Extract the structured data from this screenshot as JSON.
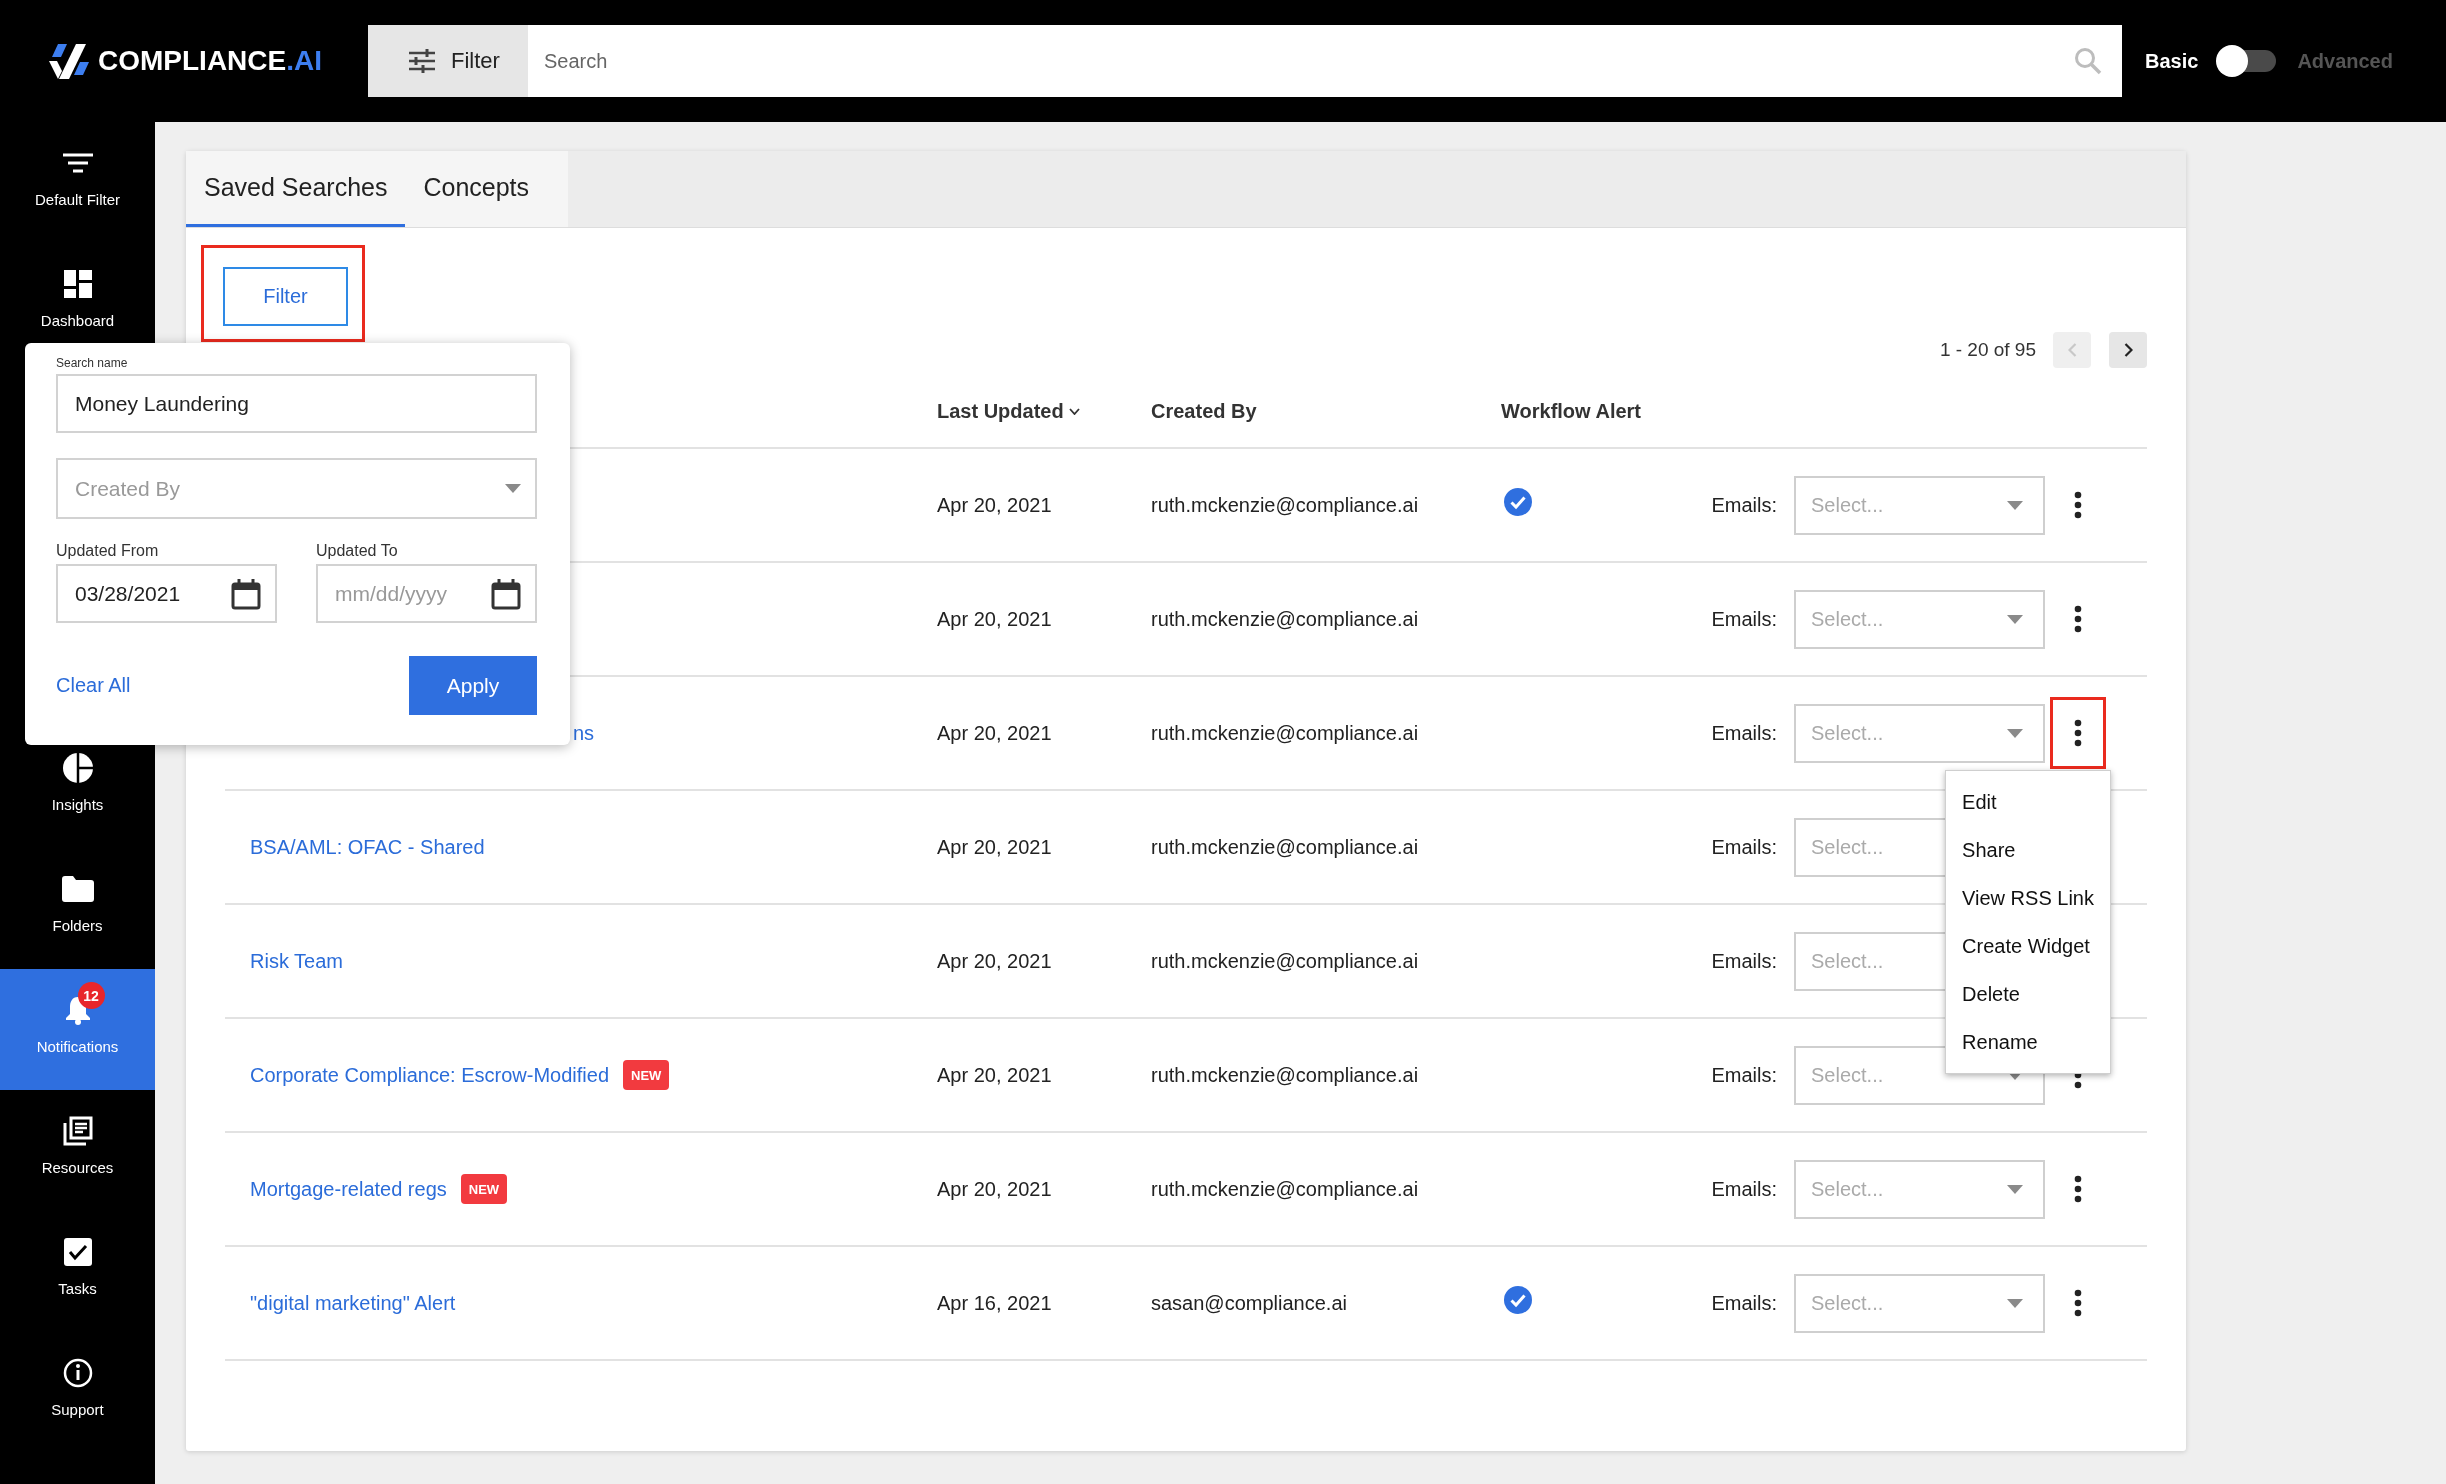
{
  "header": {
    "logo": {
      "name": "COMPLIANCE",
      "suffix": ".AI"
    },
    "filter_button": "Filter",
    "search": {
      "placeholder": "Search"
    },
    "mode_toggle": {
      "left_label": "Basic",
      "right_label": "Advanced",
      "on": false
    }
  },
  "sidebar": {
    "items": [
      {
        "label": "Default Filter",
        "selected": false
      },
      {
        "label": "Dashboard",
        "selected": false
      },
      {
        "label": "Insights",
        "selected": false
      },
      {
        "label": "Folders",
        "selected": false
      },
      {
        "label": "Notifications",
        "selected": true,
        "badge": "12"
      },
      {
        "label": "Resources",
        "selected": false
      },
      {
        "label": "Tasks",
        "selected": false
      },
      {
        "label": "Support",
        "selected": false
      }
    ]
  },
  "tabs": [
    {
      "label": "Saved Searches",
      "selected": true
    },
    {
      "label": "Concepts",
      "selected": false
    }
  ],
  "filter_button": {
    "label": "Filter",
    "highlighted": true
  },
  "filter_panel": {
    "search_name": {
      "label": "Search name",
      "value": "Money Laundering"
    },
    "created_by": {
      "placeholder": "Created By"
    },
    "updated_from": {
      "label": "Updated From",
      "value": "03/28/2021"
    },
    "updated_to": {
      "label": "Updated To",
      "placeholder": "mm/dd/yyyy"
    },
    "clear_link": "Clear All",
    "apply_button": "Apply"
  },
  "pagination": {
    "range": "1 - 20 of 95",
    "previous_disabled": true,
    "next_disabled": false
  },
  "table": {
    "columns": [
      {
        "label": "Last Updated",
        "sorted": true
      },
      {
        "label": "Created By",
        "sorted": false
      },
      {
        "label": "Workflow Alert",
        "sorted": false
      }
    ],
    "rows": [
      {
        "date": "Apr 20, 2021",
        "created_by": "ruth.mckenzie@compliance.ai",
        "workflow_alert": true,
        "emails_label": "Emails:",
        "emails": {
          "placeholder": "Select..."
        },
        "more_highlighted": false
      },
      {
        "date": "Apr 20, 2021",
        "created_by": "ruth.mckenzie@compliance.ai",
        "workflow_alert": false,
        "emails_label": "Emails:",
        "emails": {
          "placeholder": "Select..."
        },
        "more_highlighted": false
      },
      {
        "name_tail": "ns",
        "date": "Apr 20, 2021",
        "created_by": "ruth.mckenzie@compliance.ai",
        "workflow_alert": false,
        "emails_label": "Emails:",
        "emails": {
          "placeholder": "Select..."
        },
        "more_highlighted": true,
        "menu": [
          "Edit",
          "Share",
          "View RSS Link",
          "Create Widget",
          "Delete",
          "Rename"
        ]
      },
      {
        "name": "BSA/AML: OFAC - Shared",
        "date": "Apr 20, 2021",
        "created_by": "ruth.mckenzie@compliance.ai",
        "workflow_alert": false,
        "emails_label": "Emails:",
        "emails": {
          "placeholder": "Select..."
        },
        "more_highlighted": false
      },
      {
        "name": "Risk Team",
        "date": "Apr 20, 2021",
        "created_by": "ruth.mckenzie@compliance.ai",
        "workflow_alert": false,
        "emails_label": "Emails:",
        "emails": {
          "placeholder": "Select..."
        },
        "more_highlighted": false
      },
      {
        "name": "Corporate Compliance: Escrow-Modified",
        "badge": "NEW",
        "date": "Apr 20, 2021",
        "created_by": "ruth.mckenzie@compliance.ai",
        "workflow_alert": false,
        "emails_label": "Emails:",
        "emails": {
          "placeholder": "Select..."
        },
        "more_highlighted": false
      },
      {
        "name": "Mortgage-related regs",
        "badge": "NEW",
        "date": "Apr 20, 2021",
        "created_by": "ruth.mckenzie@compliance.ai",
        "workflow_alert": false,
        "emails_label": "Emails:",
        "emails": {
          "placeholder": "Select..."
        },
        "more_highlighted": false
      },
      {
        "name": "\"digital marketing\" Alert",
        "date": "Apr 16, 2021",
        "created_by": "sasan@compliance.ai",
        "workflow_alert": true,
        "emails_label": "Emails:",
        "emails": {
          "placeholder": "Select..."
        },
        "more_highlighted": false
      }
    ]
  }
}
